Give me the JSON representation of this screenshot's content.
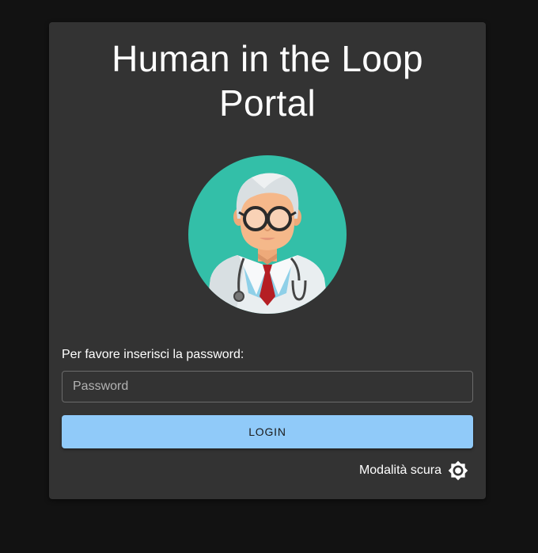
{
  "login": {
    "title": "Human in the Loop Portal",
    "password_prompt": "Per favore inserisci la password:",
    "password_placeholder": "Password",
    "login_label": "LOGIN"
  },
  "theme_toggle": {
    "label": "Modalità scura",
    "icon": "brightness-icon"
  },
  "colors": {
    "background": "#121212",
    "card": "#333333",
    "primary": "#90caf9",
    "avatar_bg": "#33bfa8"
  }
}
